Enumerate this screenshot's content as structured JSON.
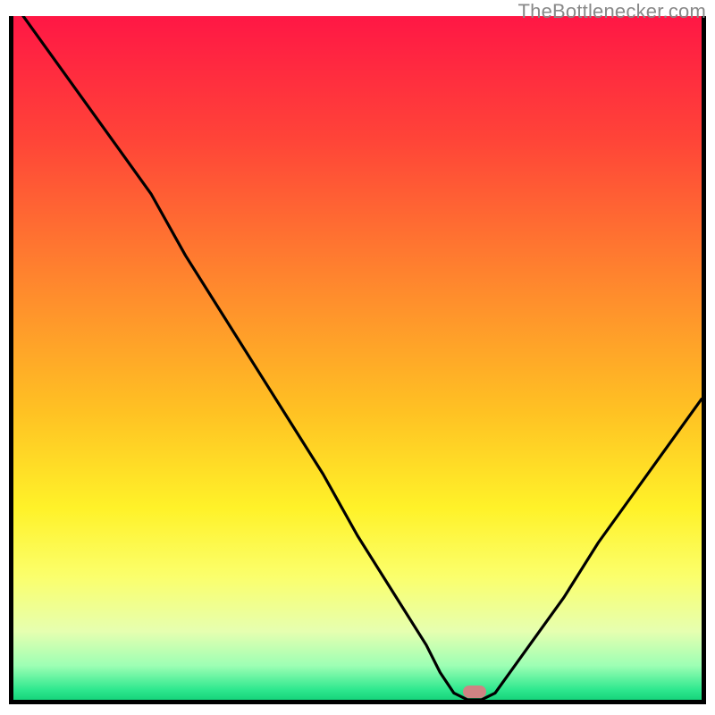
{
  "attribution": "TheBottlenecker.com",
  "chart_data": {
    "type": "line",
    "title": "",
    "xlabel": "",
    "ylabel": "",
    "xlim": [
      0,
      100
    ],
    "ylim": [
      0,
      100
    ],
    "x": [
      0,
      5,
      10,
      15,
      20,
      25,
      30,
      35,
      40,
      45,
      50,
      55,
      60,
      62,
      64,
      66,
      68,
      70,
      75,
      80,
      85,
      90,
      95,
      100
    ],
    "values": [
      102,
      95,
      88,
      81,
      74,
      65,
      57,
      49,
      41,
      33,
      24,
      16,
      8,
      4,
      1,
      0,
      0,
      1,
      8,
      15,
      23,
      30,
      37,
      44
    ],
    "marker": {
      "x_percent": 67,
      "y_percent": 0,
      "color": "#cf8383"
    },
    "background_gradient": {
      "stops": [
        {
          "pos": 0.0,
          "color": "#ff1745"
        },
        {
          "pos": 0.18,
          "color": "#ff4438"
        },
        {
          "pos": 0.4,
          "color": "#ff8a2d"
        },
        {
          "pos": 0.58,
          "color": "#ffc223"
        },
        {
          "pos": 0.72,
          "color": "#fff229"
        },
        {
          "pos": 0.82,
          "color": "#fbff6c"
        },
        {
          "pos": 0.9,
          "color": "#e6ffb0"
        },
        {
          "pos": 0.95,
          "color": "#9dffb4"
        },
        {
          "pos": 0.985,
          "color": "#2fe88f"
        },
        {
          "pos": 1.0,
          "color": "#17d47b"
        }
      ]
    }
  }
}
